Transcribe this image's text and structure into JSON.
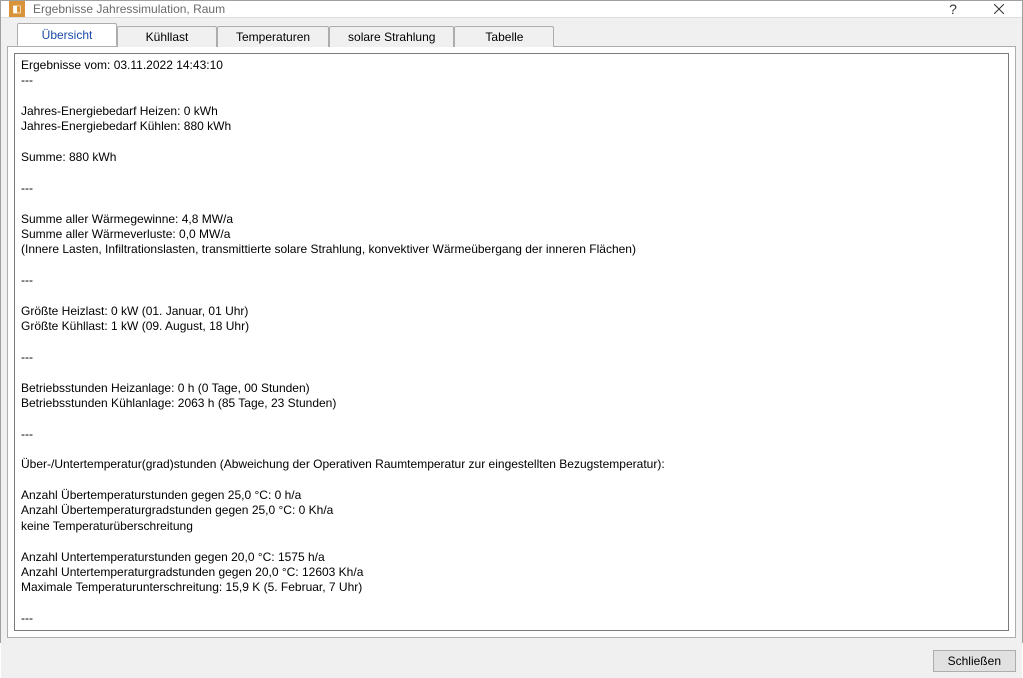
{
  "window": {
    "title": "Ergebnisse Jahressimulation, Raum"
  },
  "tabs": {
    "t0": "Übersicht",
    "t1": "Kühllast",
    "t2": "Temperaturen",
    "t3": "solare Strahlung",
    "t4": "Tabelle"
  },
  "results": {
    "header_line": "Ergebnisse vom: 03.11.2022 14:43:10",
    "sep": "---",
    "energy_heating": "Jahres-Energiebedarf Heizen: 0 kWh",
    "energy_cooling": "Jahres-Energiebedarf Kühlen: 880 kWh",
    "sum_line": "Summe: 880 kWh",
    "gains_sum": "Summe aller Wärmegewinne: 4,8 MW/a",
    "losses_sum": "Summe aller Wärmeverluste: 0,0 MW/a",
    "gains_note": "(Innere Lasten, Infiltrationslasten, transmittierte solare Strahlung, konvektiver Wärmeübergang der inneren Flächen)",
    "max_heat": "Größte Heizlast: 0 kW (01. Januar, 01 Uhr)",
    "max_cool": "Größte Kühllast: 1 kW (09. August, 18 Uhr)",
    "op_hours_heat": "Betriebsstunden Heizanlage: 0 h (0 Tage, 00 Stunden)",
    "op_hours_cool": "Betriebsstunden Kühlanlage: 2063 h (85 Tage, 23 Stunden)",
    "temp_dev_header": "Über-/Untertemperatur(grad)stunden (Abweichung der Operativen Raumtemperatur zur eingestellten Bezugstemperatur):",
    "over_h": "Anzahl Übertemperaturstunden gegen 25,0 °C: 0 h/a",
    "over_kh": "Anzahl Übertemperaturgradstunden gegen 25,0 °C: 0 Kh/a",
    "over_none": "keine Temperaturüberschreitung",
    "under_h": "Anzahl Untertemperaturstunden gegen 20,0 °C: 1575 h/a",
    "under_kh": "Anzahl Untertemperaturgradstunden gegen 20,0 °C: 12603 Kh/a",
    "under_max": "Maximale Temperaturunterschreitung: 15,9 K (5. Februar, 7 Uhr)"
  },
  "buttons": {
    "close": "Schließen"
  }
}
